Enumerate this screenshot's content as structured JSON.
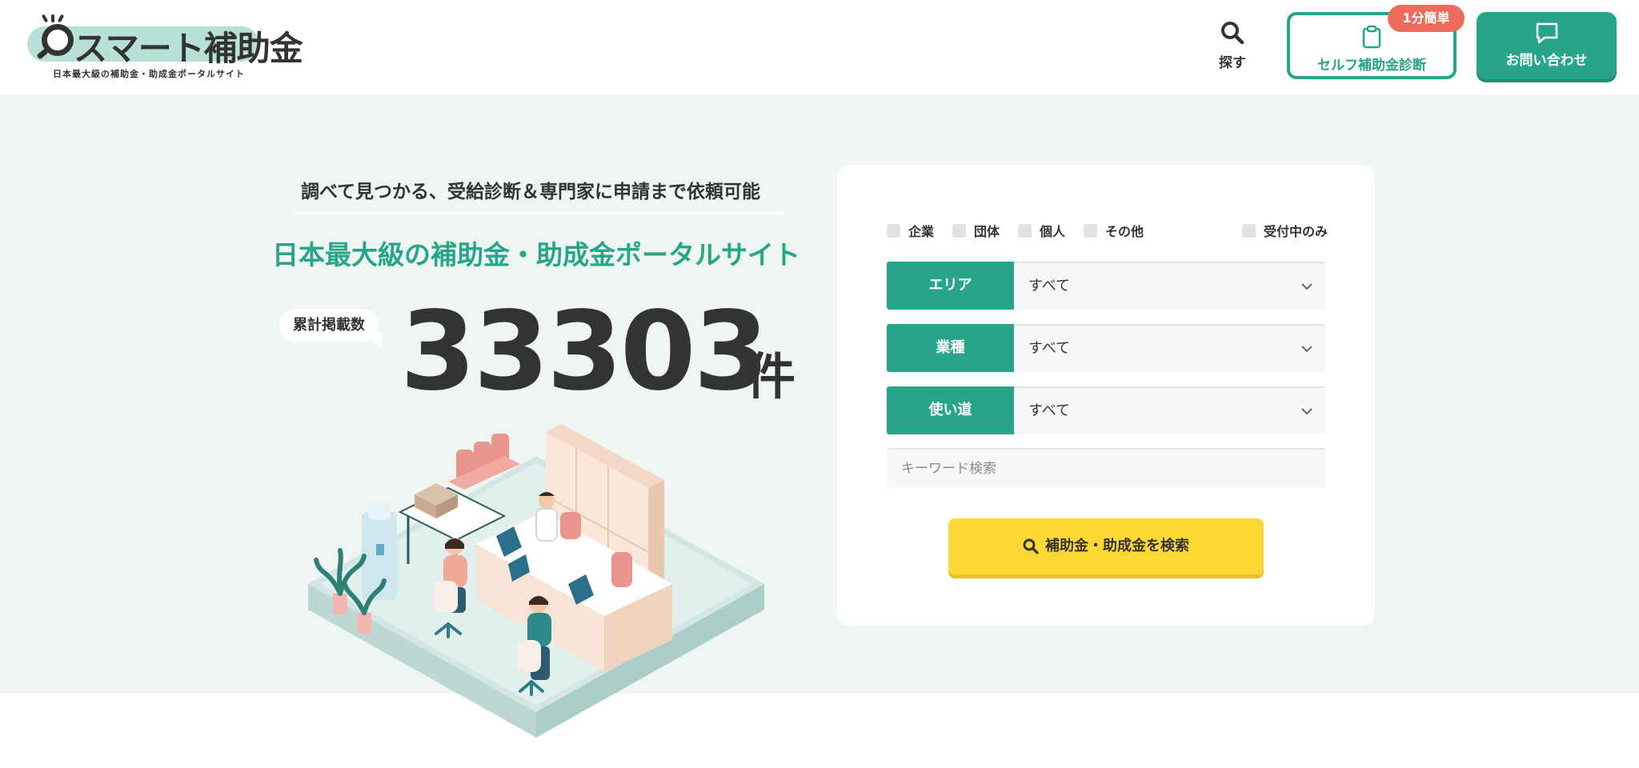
{
  "header": {
    "logo_text": "スマート補助金",
    "logo_subtitle": "日本最大級の補助金・助成金ポータルサイト",
    "nav_search_label": "探す",
    "self_diagnosis_label": "セルフ補助金診断",
    "self_diagnosis_badge": "1分簡単",
    "contact_label": "お問い合わせ"
  },
  "hero": {
    "tagline": "調べて見つかる、受給診断＆専門家に申請まで依頼可能",
    "headline": "日本最大級の補助金・助成金ポータルサイト",
    "count_label": "累計掲載数",
    "count_value": "33303",
    "count_unit": "件"
  },
  "search": {
    "checkboxes": [
      {
        "label": "企業",
        "checked": false
      },
      {
        "label": "団体",
        "checked": false
      },
      {
        "label": "個人",
        "checked": false
      },
      {
        "label": "その他",
        "checked": false
      }
    ],
    "open_only": {
      "label": "受付中のみ",
      "checked": false
    },
    "selects": [
      {
        "label": "エリア",
        "value": "すべて"
      },
      {
        "label": "業種",
        "value": "すべて"
      },
      {
        "label": "使い道",
        "value": "すべて"
      }
    ],
    "keyword_placeholder": "キーワード検索",
    "submit_label": "補助金・助成金を検索"
  },
  "colors": {
    "brand_green": "#26a58a",
    "hero_background": "#eff6f2",
    "search_button": "#fdd835",
    "badge": "#ec6b5a"
  }
}
